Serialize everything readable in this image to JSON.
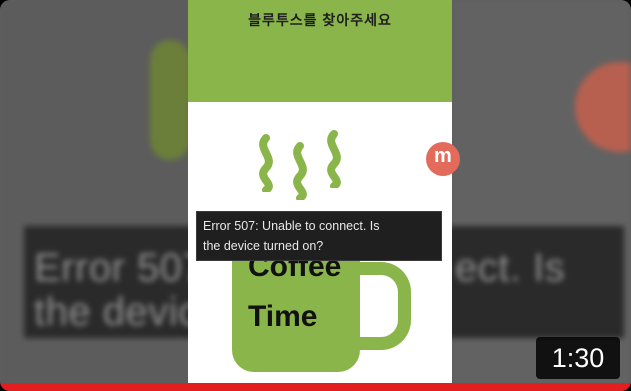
{
  "app_title": "블루투스를 찾아주세요",
  "error": {
    "line1": "Error 507: Unable to connect. Is",
    "line2": "the device turned on?"
  },
  "mug": {
    "word1": "Coffee",
    "word2": "Time"
  },
  "background_text": {
    "row1_left": "Error 507",
    "row1_right": "ect. Is",
    "row2_left": "the devic"
  },
  "logo_letter": "m",
  "duration": "1:30",
  "progress": {
    "watched_fraction": 1.0
  },
  "colors": {
    "accent_green": "#8ab54a",
    "progress_red": "#e31e1e",
    "logo_red": "#e26b5b"
  }
}
